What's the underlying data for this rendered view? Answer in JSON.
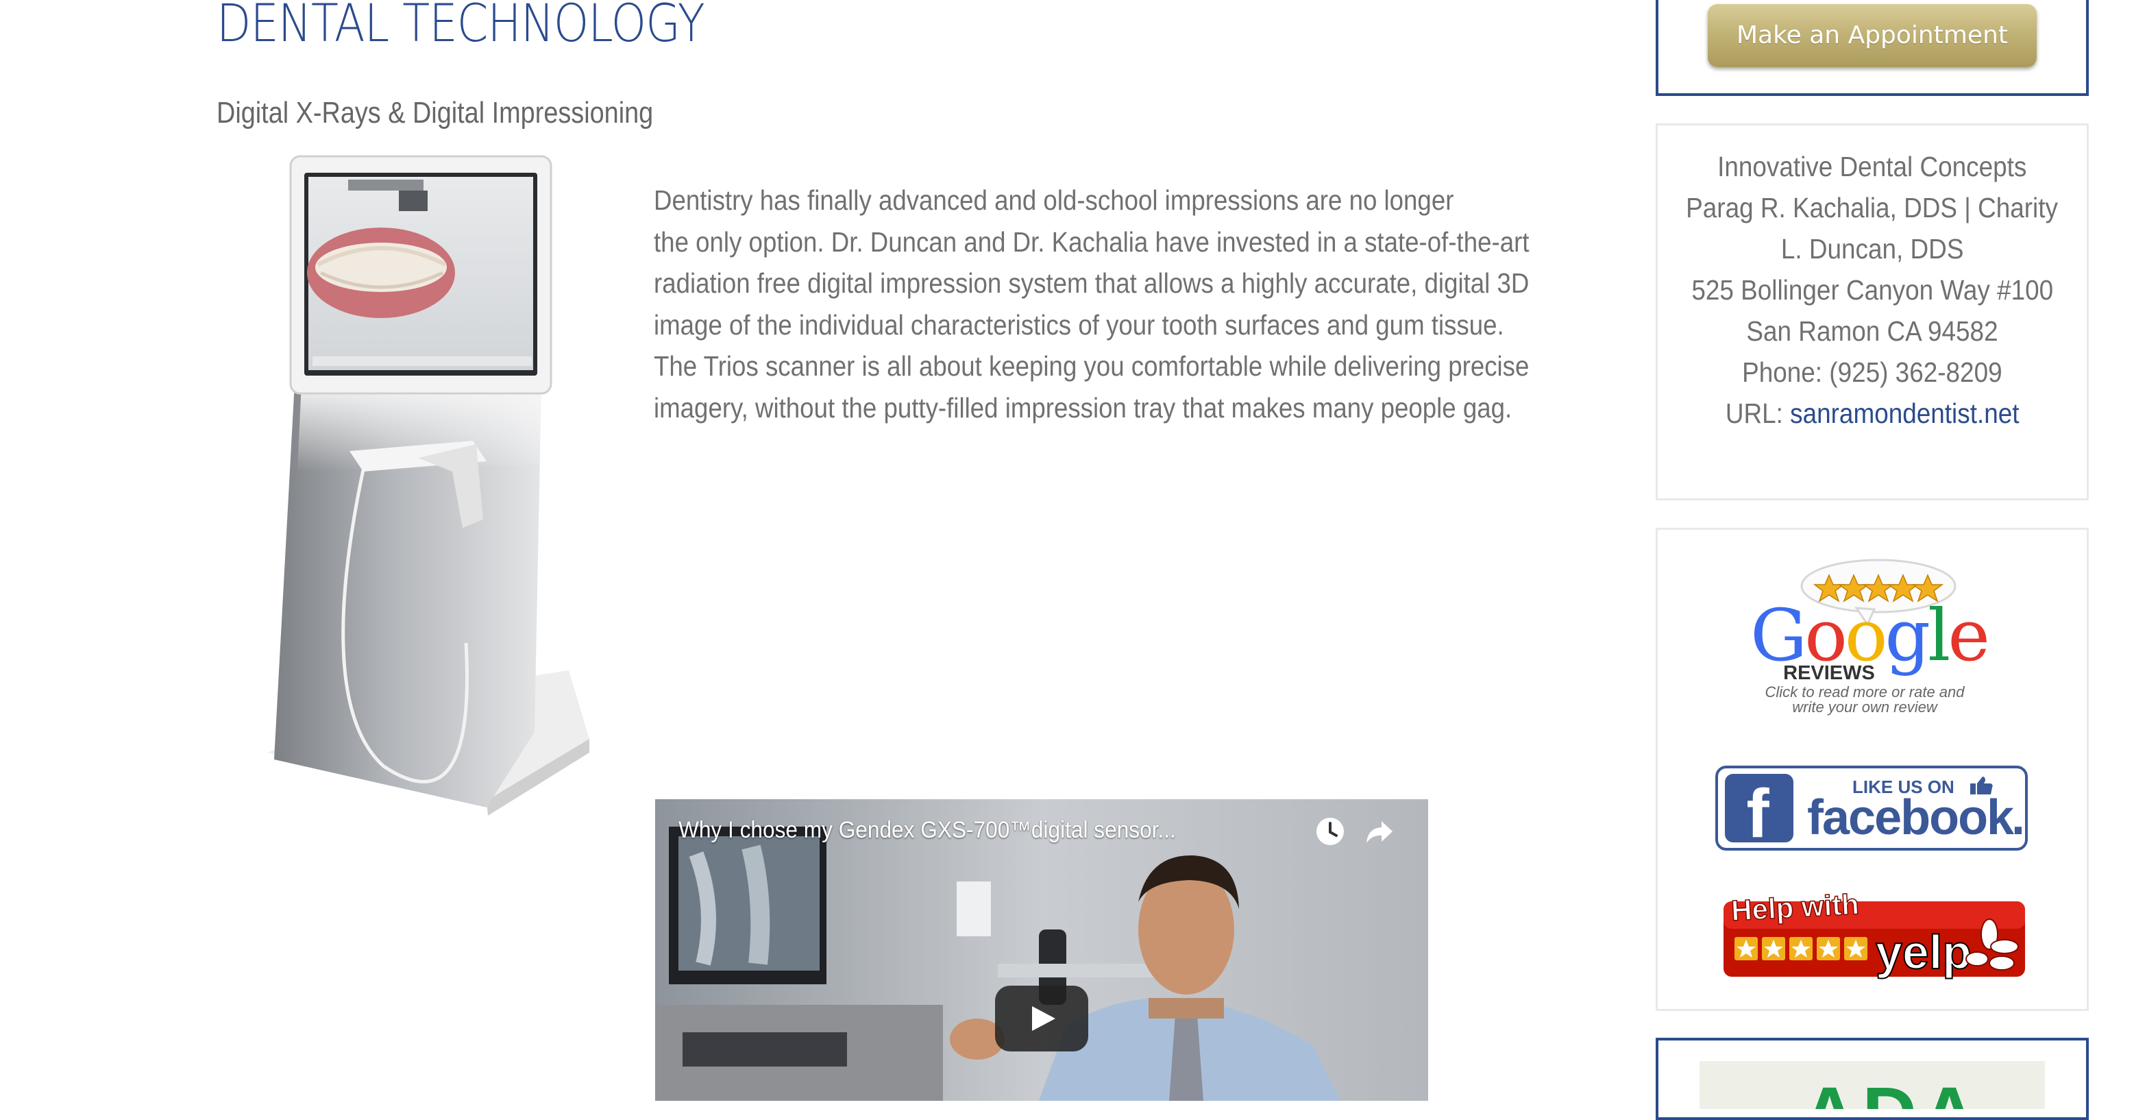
{
  "main": {
    "title": "DENTAL TECHNOLOGY",
    "subtitle": "Digital X-Rays & Digital Impressioning",
    "paragraph_lines": [
      "Dentistry has finally advanced and old-school impressions are no longer",
      "the only option. Dr. Duncan and Dr. Kachalia have invested in a state-of-the-art",
      "radiation free digital impression system that allows a highly accurate, digital 3D",
      "image of the individual characteristics of your tooth surfaces and gum tissue.",
      "The Trios scanner is all about keeping you comfortable while delivering precise",
      "imagery, without the putty-filled impression tray that makes many people gag."
    ]
  },
  "video": {
    "title": "Why I chose my Gendex GXS-700™digital sensor...",
    "watch_later_icon": "clock-icon",
    "share_icon": "share-arrow-icon",
    "play_icon": "play-icon"
  },
  "sidebar": {
    "appointment_label": "Make an Appointment",
    "contact": {
      "line1": "Innovative Dental Concepts",
      "line2": "Parag R. Kachalia, DDS | Charity",
      "line3": "L. Duncan, DDS",
      "address1": "525 Bollinger Canyon Way #100",
      "address2": "San Ramon CA 94582",
      "phone": "Phone: (925) 362-8209",
      "url_label": "URL: ",
      "url_text": "sanramondentist.net"
    },
    "google": {
      "word": "Google",
      "reviews": "REVIEWS",
      "caption1": "Click to read more or rate and",
      "caption2": "write your own review"
    },
    "facebook": {
      "like_us_on": "LIKE US ON",
      "word": "facebook",
      "period": "."
    },
    "yelp": {
      "help_with": "Help with",
      "word": "yelp"
    },
    "bottom_logo_text": "ADA"
  },
  "colors": {
    "title_blue": "#2a4b8d",
    "body_gray": "#707070",
    "gold_button": "#c2b377",
    "facebook_blue": "#3b5998",
    "yelp_red": "#c41200",
    "google_blue": "#3b6cf0",
    "google_red": "#e6352b",
    "google_yellow": "#f4b400",
    "google_green": "#169a48",
    "star_gold": "#f2b01e"
  }
}
